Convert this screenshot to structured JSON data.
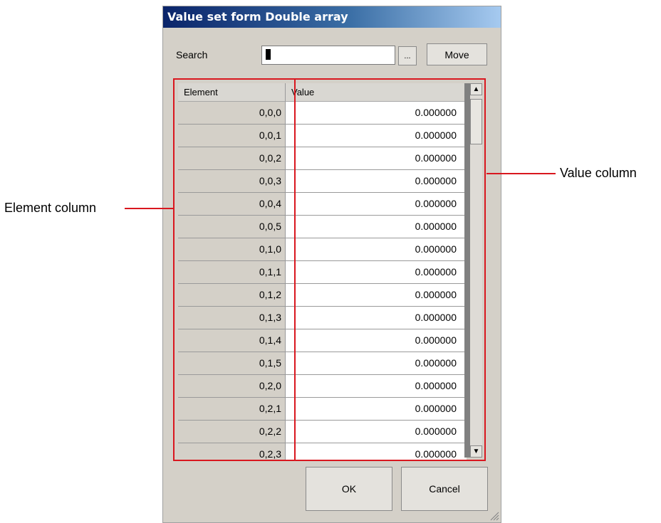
{
  "dialog": {
    "title": "Value set form Double array",
    "search_label": "Search",
    "search_value": "",
    "browse_label": "...",
    "move_label": "Move",
    "ok_label": "OK",
    "cancel_label": "Cancel"
  },
  "table": {
    "headers": [
      "Element",
      "Value"
    ],
    "rows": [
      {
        "element": "0,0,0",
        "value": "0.000000"
      },
      {
        "element": "0,0,1",
        "value": "0.000000"
      },
      {
        "element": "0,0,2",
        "value": "0.000000"
      },
      {
        "element": "0,0,3",
        "value": "0.000000"
      },
      {
        "element": "0,0,4",
        "value": "0.000000"
      },
      {
        "element": "0,0,5",
        "value": "0.000000"
      },
      {
        "element": "0,1,0",
        "value": "0.000000"
      },
      {
        "element": "0,1,1",
        "value": "0.000000"
      },
      {
        "element": "0,1,2",
        "value": "0.000000"
      },
      {
        "element": "0,1,3",
        "value": "0.000000"
      },
      {
        "element": "0,1,4",
        "value": "0.000000"
      },
      {
        "element": "0,1,5",
        "value": "0.000000"
      },
      {
        "element": "0,2,0",
        "value": "0.000000"
      },
      {
        "element": "0,2,1",
        "value": "0.000000"
      },
      {
        "element": "0,2,2",
        "value": "0.000000"
      },
      {
        "element": "0,2,3",
        "value": "0.000000"
      }
    ]
  },
  "annotations": {
    "element_column": "Element column",
    "value_column": "Value column"
  },
  "colors": {
    "annotation": "#d9171f",
    "titlebar": "#0a246a",
    "dialog_bg": "#d4d0c8"
  },
  "icons": [
    "scroll-up-arrow-icon",
    "scroll-down-arrow-icon",
    "resize-grip-icon"
  ]
}
